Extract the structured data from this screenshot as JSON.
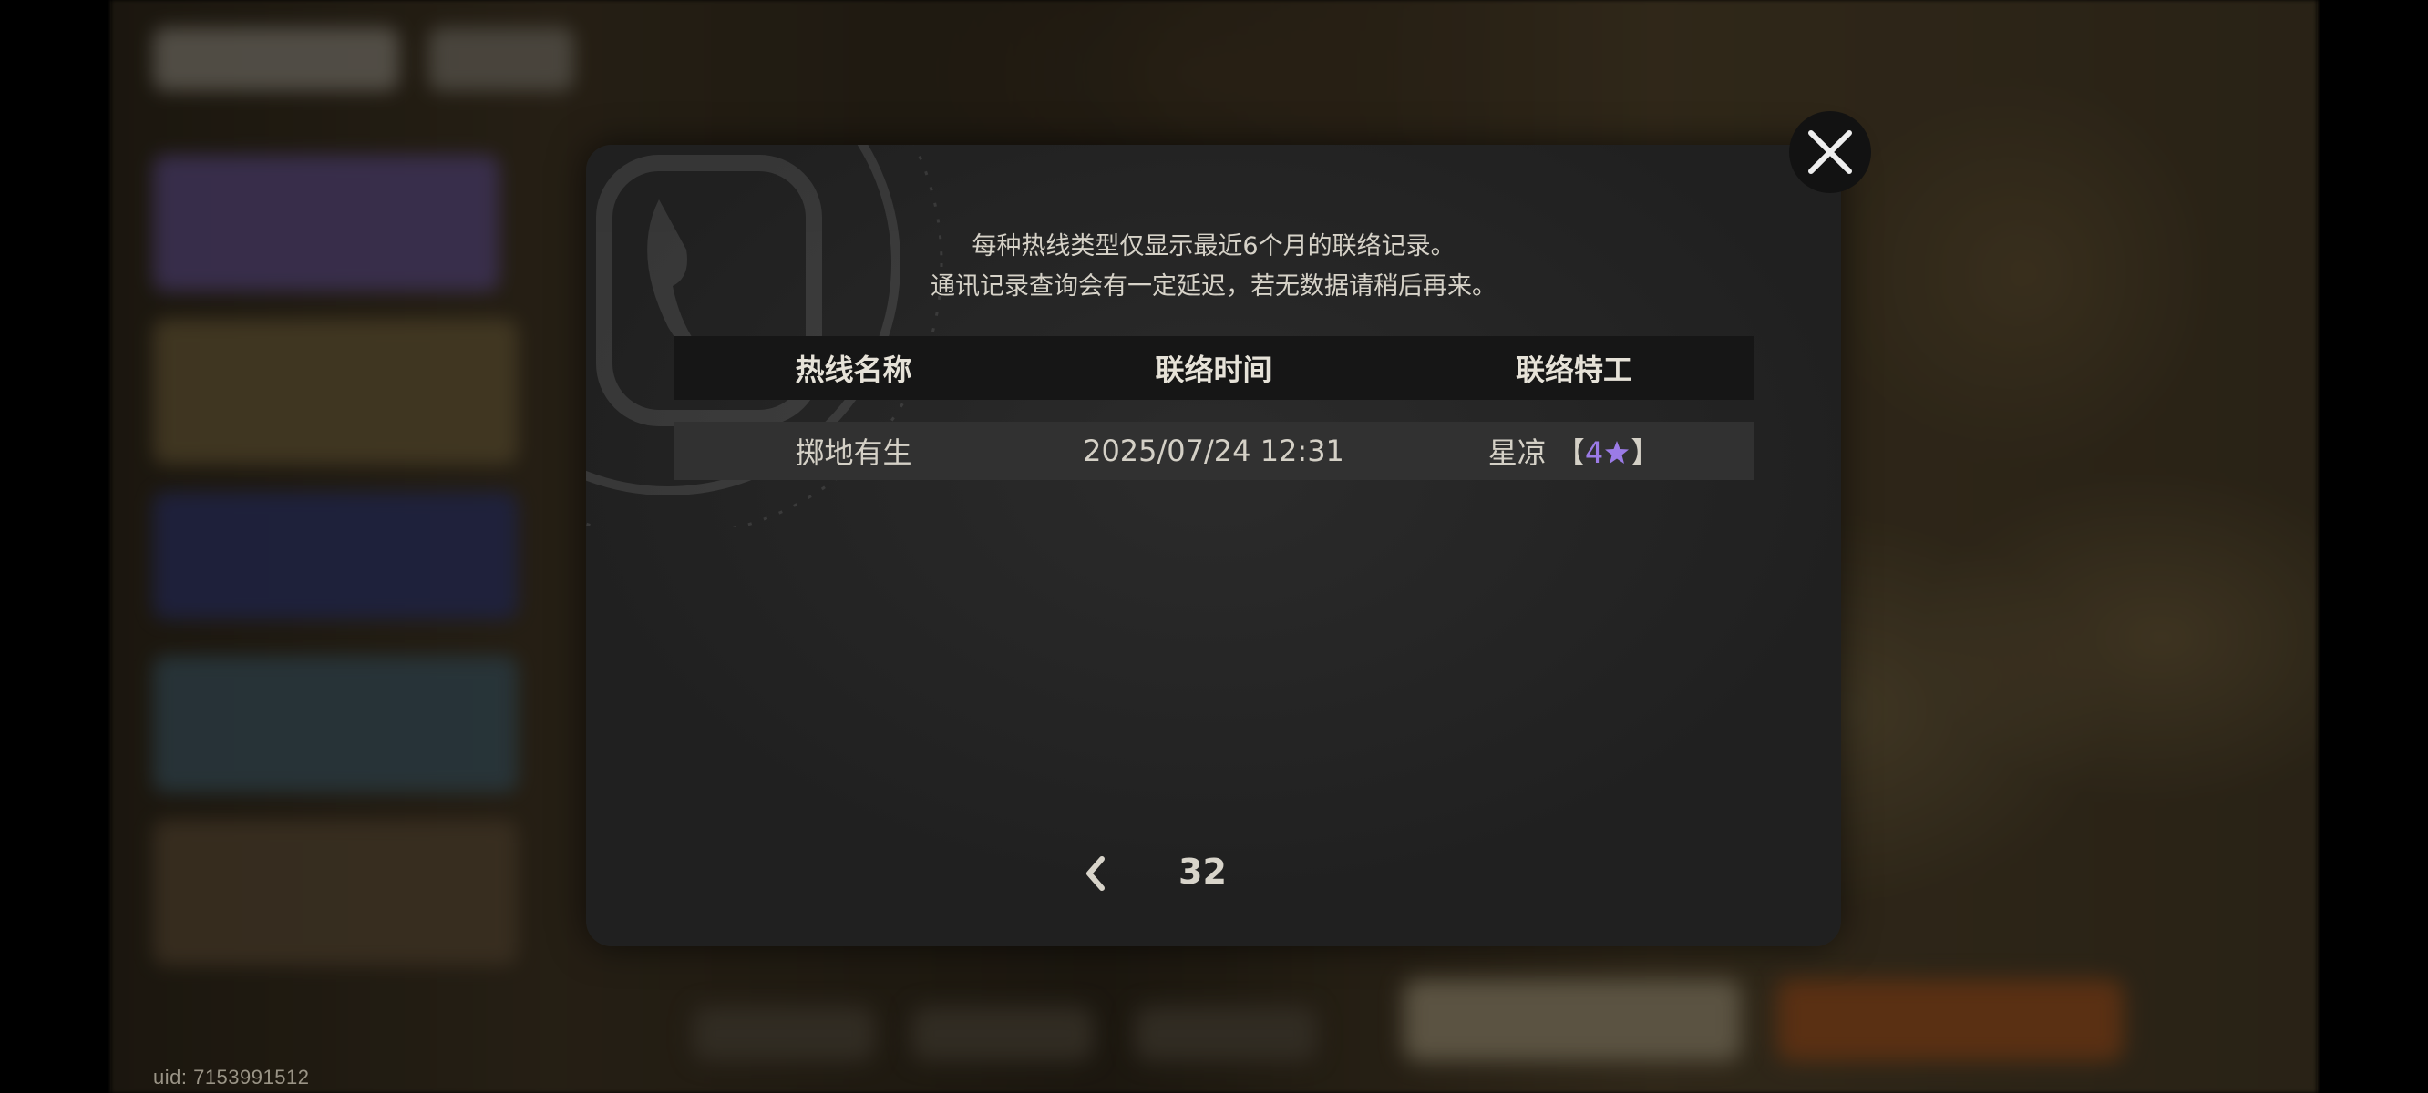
{
  "background": {
    "uid_label": "uid: 7153991512"
  },
  "dialog": {
    "notice_line_1": "每种热线类型仅显示最近6个月的联络记录。",
    "notice_line_2": "通讯记录查询会有一定延迟，若无数据请稍后再来。",
    "table": {
      "headers": [
        "热线名称",
        "联络时间",
        "联络特工"
      ],
      "rows": [
        {
          "hotline_name": "掷地有生",
          "contact_time": "2025/07/24 12:31",
          "agent_name": "星凉",
          "rarity_open": "【",
          "rarity_value": "4",
          "rarity_close": "】",
          "rarity_icon": "star-icon",
          "rarity_color": "#9b7be6"
        }
      ]
    },
    "pagination": {
      "prev_icon": "chevron-left-icon",
      "current_page": "32"
    },
    "close_icon": "close-icon"
  }
}
